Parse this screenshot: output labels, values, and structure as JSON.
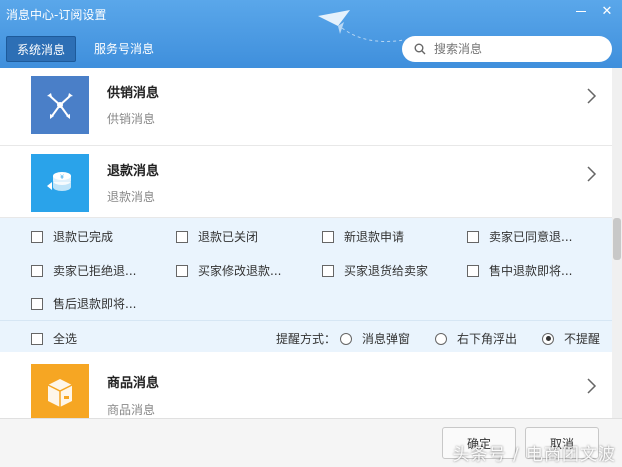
{
  "window": {
    "title": "消息中心-订阅设置"
  },
  "tabs": [
    {
      "label": "系统消息",
      "active": true
    },
    {
      "label": "服务号消息",
      "active": false
    }
  ],
  "search": {
    "placeholder": "搜索消息"
  },
  "items": [
    {
      "title": "供销消息",
      "subtitle": "供销消息",
      "icon": "network-icon",
      "color": "#4a7fc8"
    },
    {
      "title": "退款消息",
      "subtitle": "退款消息",
      "icon": "coin-refund-icon",
      "color": "#2aa3ea"
    },
    {
      "title": "商品消息",
      "subtitle": "商品消息",
      "icon": "package-icon",
      "color": "#f6a623"
    }
  ],
  "refund_options": {
    "checkboxes": [
      "退款已完成",
      "退款已关闭",
      "新退款申请",
      "卖家已同意退...",
      "卖家已拒绝退...",
      "买家修改退款...",
      "买家退货给卖家",
      "售中退款即将...",
      "售后退款即将..."
    ],
    "select_all": "全选",
    "remind_label": "提醒方式：",
    "remind_options": [
      {
        "label": "消息弹窗",
        "selected": false
      },
      {
        "label": "右下角浮出",
        "selected": false
      },
      {
        "label": "不提醒",
        "selected": true
      }
    ]
  },
  "footer": {
    "confirm": "确定",
    "cancel": "取消"
  },
  "watermark": "头条号 / 电商团文波"
}
